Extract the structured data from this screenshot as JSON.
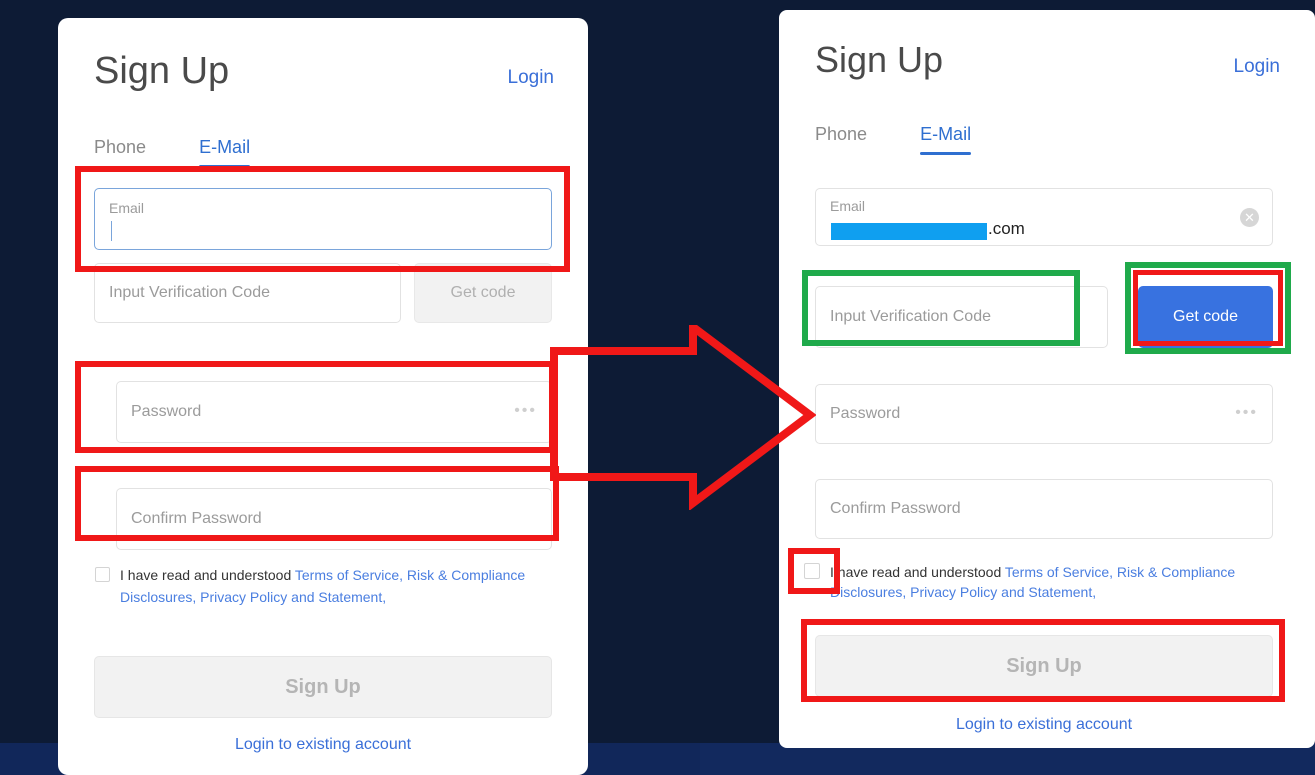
{
  "background": {
    "color": "#0d1b35",
    "band_color": "#11275a"
  },
  "colors": {
    "link_blue": "#3a6fd8",
    "tab_active_blue": "#2f6fd0",
    "primary_button_blue": "#3872e0",
    "redaction_blue": "#0f9ff0",
    "annotation_red": "#f01818",
    "annotation_green": "#1faa4b",
    "disabled_grey": "#f2f2f2"
  },
  "left_panel": {
    "header": {
      "title": "Sign Up",
      "login_label": "Login"
    },
    "tabs": [
      {
        "label": "Phone",
        "active": false
      },
      {
        "label": "E-Mail",
        "active": true
      }
    ],
    "email_field": {
      "label": "Email",
      "value": "",
      "focused": true
    },
    "verification_field": {
      "placeholder": "Input Verification Code",
      "value": ""
    },
    "get_code_button": {
      "label": "Get code",
      "enabled": false
    },
    "password_field": {
      "placeholder": "Password",
      "value": "",
      "toggle_icon": "ellipsis-icon"
    },
    "confirm_password_field": {
      "placeholder": "Confirm Password",
      "value": ""
    },
    "terms": {
      "checked": false,
      "prefix": "I have read and understood ",
      "links": [
        "Terms of Service,",
        "Risk & Compliance Disclosures,",
        "Privacy Policy and Statement,"
      ]
    },
    "signup_button": {
      "label": "Sign Up",
      "enabled": false
    },
    "bottom_link": "Login to existing account"
  },
  "right_panel": {
    "header": {
      "title": "Sign Up",
      "login_label": "Login"
    },
    "tabs": [
      {
        "label": "Phone",
        "active": false
      },
      {
        "label": "E-Mail",
        "active": true
      }
    ],
    "email_field": {
      "label": "Email",
      "value_redacted": true,
      "value_suffix": ".com",
      "clear_icon": "close-circle-icon"
    },
    "verification_field": {
      "placeholder": "Input Verification Code",
      "value": ""
    },
    "get_code_button": {
      "label": "Get code",
      "enabled": true
    },
    "password_field": {
      "placeholder": "Password",
      "value": "",
      "toggle_icon": "ellipsis-icon"
    },
    "confirm_password_field": {
      "placeholder": "Confirm Password",
      "value": ""
    },
    "terms": {
      "checked": false,
      "prefix": "I have read and understood ",
      "links": [
        "Terms of Service,",
        "Risk & Compliance Disclosures,",
        "Privacy Policy and Statement,"
      ]
    },
    "signup_button": {
      "label": "Sign Up",
      "enabled": false
    },
    "bottom_link": "Login to existing account"
  },
  "annotations": {
    "arrow": {
      "direction": "right",
      "style": "outlined",
      "color": "#f01818"
    },
    "boxes": [
      {
        "target": "left-email-field",
        "color": "#f01818"
      },
      {
        "target": "left-password-field",
        "color": "#f01818"
      },
      {
        "target": "left-confirm-password-field",
        "color": "#f01818"
      },
      {
        "target": "right-verification-field",
        "color": "#1faa4b"
      },
      {
        "target": "right-get-code-button-outer",
        "color": "#1faa4b"
      },
      {
        "target": "right-get-code-button-inner",
        "color": "#f01818"
      },
      {
        "target": "right-terms-checkbox",
        "color": "#f01818"
      },
      {
        "target": "right-signup-button",
        "color": "#f01818"
      }
    ]
  }
}
